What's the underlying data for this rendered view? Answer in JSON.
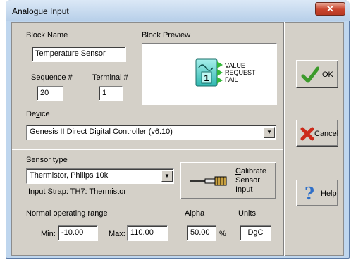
{
  "window": {
    "title": "Analogue Input",
    "close_glyph": "✕"
  },
  "block": {
    "name_label": "Block Name",
    "name_value": "Temperature Sensor",
    "preview_label": "Block Preview",
    "sequence_label": "Sequence #",
    "sequence_value": "20",
    "terminal_label": "Terminal #",
    "terminal_value": "1",
    "preview_number": "1",
    "preview_outputs": [
      "VALUE",
      "REQUEST",
      "FAIL"
    ]
  },
  "device": {
    "label_prefix": "De",
    "label_underlined": "v",
    "label_suffix": "ice",
    "value": "Genesis II Direct Digital Controller (v6.10)"
  },
  "sensor": {
    "label": "Sensor type",
    "value": "Thermistor, Philips 10k",
    "strap": "Input Strap: TH7: Thermistor"
  },
  "calibrate": {
    "line1_first": "C",
    "line1_rest": "alibrate",
    "line2": "Sensor",
    "line3": "Input"
  },
  "range": {
    "label": "Normal operating range",
    "min_label": "Min:",
    "min_value": "-10.00",
    "max_label": "Max:",
    "max_value": "110.00"
  },
  "alpha": {
    "label": "Alpha",
    "value": "50.00",
    "unit": "%"
  },
  "units": {
    "label": "Units",
    "value": "DgC"
  },
  "buttons": {
    "ok": "OK",
    "cancel": "Cancel",
    "help": "Help"
  },
  "icons": {
    "close": "close-icon",
    "ok": "checkmark-icon",
    "cancel": "x-mark-icon",
    "help": "question-mark-icon",
    "calibrate": "sensor-probe-icon"
  },
  "colors": {
    "ok_green": "#3c9a2c",
    "cancel_red": "#cc2a1a",
    "help_blue": "#2f6fc8",
    "preview_teal": "#3ec8c0",
    "preview_arrow_green": "#36b83c"
  }
}
